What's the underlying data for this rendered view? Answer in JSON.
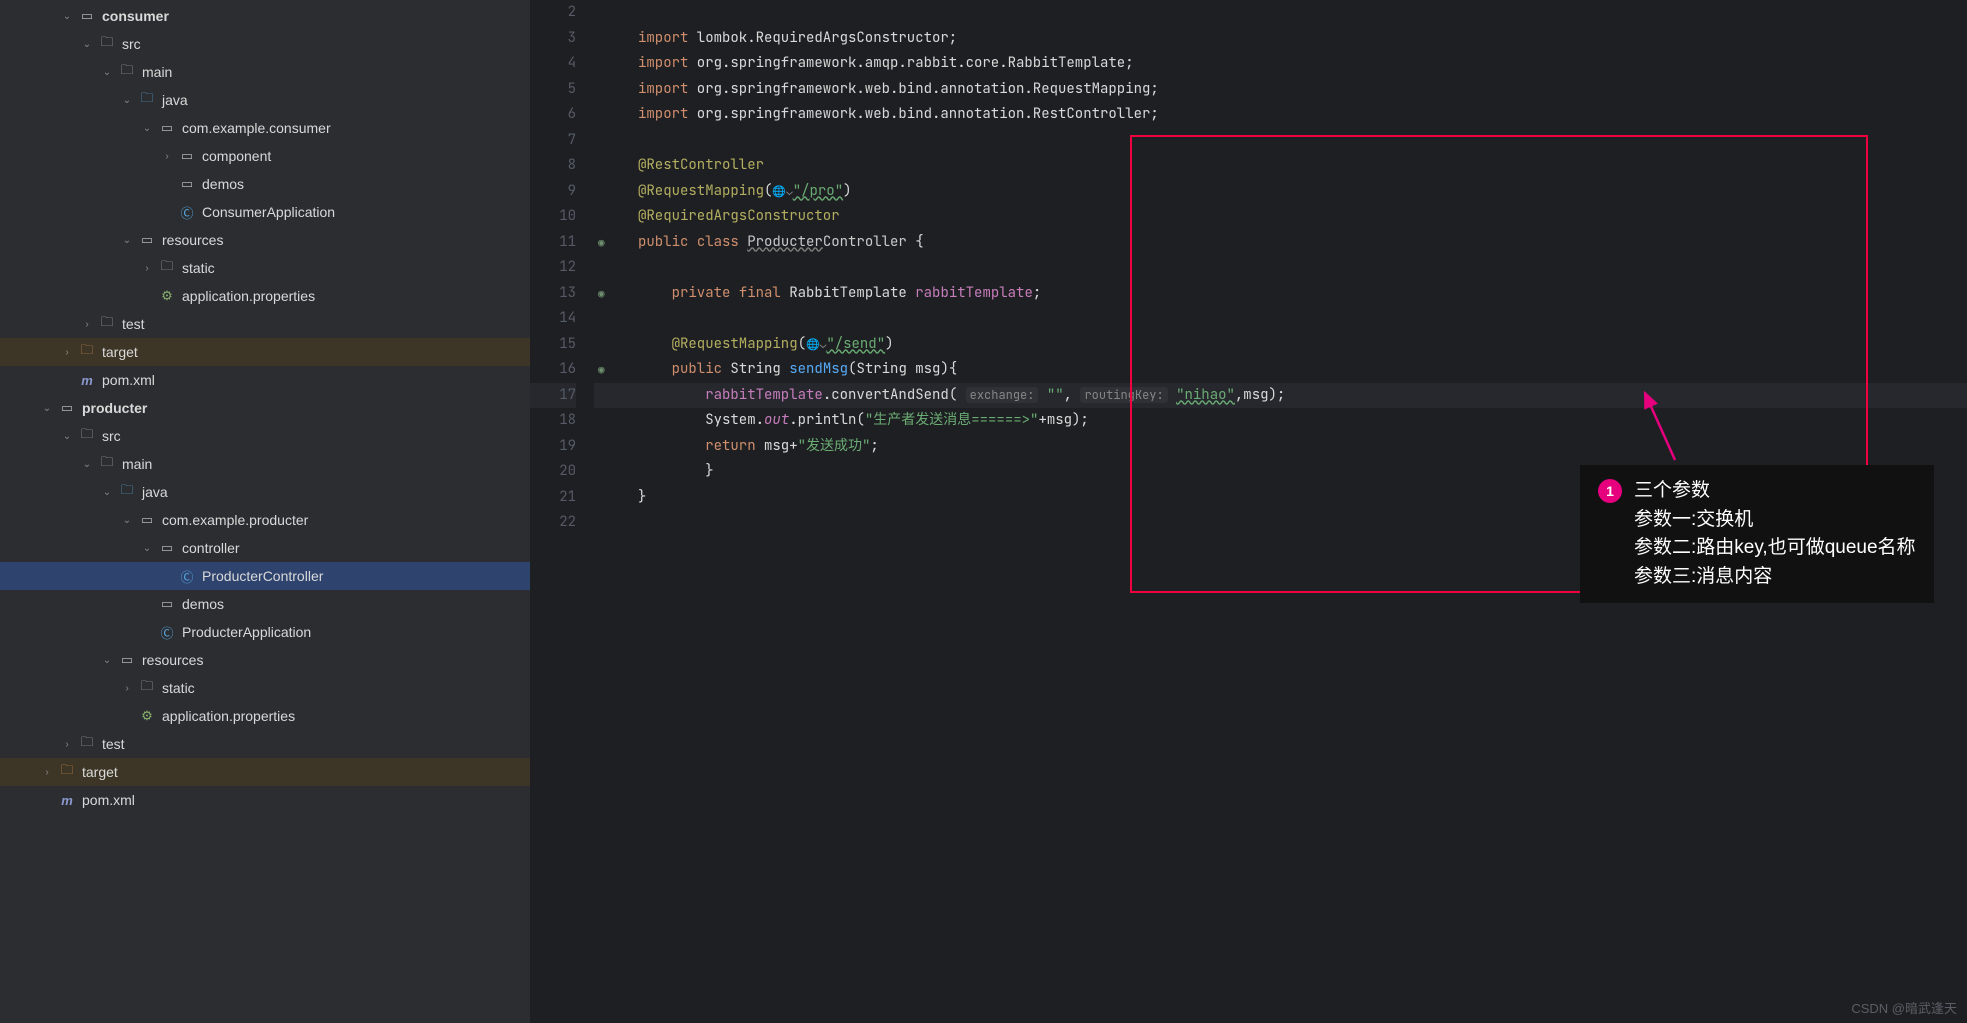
{
  "sidebar": {
    "items": [
      {
        "depth": 3,
        "arrow": "down",
        "icon": "module",
        "label": "consumer",
        "bold": true
      },
      {
        "depth": 4,
        "arrow": "down",
        "icon": "folder",
        "label": "src"
      },
      {
        "depth": 5,
        "arrow": "down",
        "icon": "folder",
        "label": "main"
      },
      {
        "depth": 6,
        "arrow": "down",
        "icon": "folder-src",
        "label": "java"
      },
      {
        "depth": 7,
        "arrow": "down",
        "icon": "package",
        "label": "com.example.consumer"
      },
      {
        "depth": 8,
        "arrow": "right",
        "icon": "package",
        "label": "component"
      },
      {
        "depth": 8,
        "arrow": "",
        "icon": "package",
        "label": "demos"
      },
      {
        "depth": 8,
        "arrow": "",
        "icon": "class",
        "label": "ConsumerApplication"
      },
      {
        "depth": 6,
        "arrow": "down",
        "icon": "res",
        "label": "resources"
      },
      {
        "depth": 7,
        "arrow": "right",
        "icon": "folder",
        "label": "static"
      },
      {
        "depth": 7,
        "arrow": "",
        "icon": "prop",
        "label": "application.properties"
      },
      {
        "depth": 4,
        "arrow": "right",
        "icon": "folder",
        "label": "test"
      },
      {
        "depth": 3,
        "arrow": "right",
        "icon": "folder-tgt",
        "label": "target",
        "hl": true
      },
      {
        "depth": 3,
        "arrow": "",
        "icon": "maven",
        "label": "pom.xml"
      },
      {
        "depth": 2,
        "arrow": "down",
        "icon": "module",
        "label": "producter",
        "bold": true
      },
      {
        "depth": 3,
        "arrow": "down",
        "icon": "folder",
        "label": "src"
      },
      {
        "depth": 4,
        "arrow": "down",
        "icon": "folder",
        "label": "main"
      },
      {
        "depth": 5,
        "arrow": "down",
        "icon": "folder-src",
        "label": "java"
      },
      {
        "depth": 6,
        "arrow": "down",
        "icon": "package",
        "label": "com.example.producter"
      },
      {
        "depth": 7,
        "arrow": "down",
        "icon": "package",
        "label": "controller"
      },
      {
        "depth": 8,
        "arrow": "",
        "icon": "class",
        "label": "ProducterController",
        "selected": true
      },
      {
        "depth": 7,
        "arrow": "",
        "icon": "package",
        "label": "demos"
      },
      {
        "depth": 7,
        "arrow": "",
        "icon": "class",
        "label": "ProducterApplication"
      },
      {
        "depth": 5,
        "arrow": "down",
        "icon": "res",
        "label": "resources"
      },
      {
        "depth": 6,
        "arrow": "right",
        "icon": "folder",
        "label": "static"
      },
      {
        "depth": 6,
        "arrow": "",
        "icon": "prop",
        "label": "application.properties"
      },
      {
        "depth": 3,
        "arrow": "right",
        "icon": "folder",
        "label": "test"
      },
      {
        "depth": 2,
        "arrow": "right",
        "icon": "folder-tgt",
        "label": "target",
        "hl": true
      },
      {
        "depth": 2,
        "arrow": "",
        "icon": "maven",
        "label": "pom.xml"
      }
    ]
  },
  "gutter": {
    "start": 2,
    "end": 22,
    "current": 17,
    "spring_lines": [
      11,
      13,
      16
    ]
  },
  "code": {
    "l2": "",
    "l3": {
      "kw": "import",
      "rest": " lombok.RequiredArgsConstructor;"
    },
    "l4": {
      "kw": "import",
      "rest": " org.springframework.amqp.rabbit.core.RabbitTemplate;"
    },
    "l5": {
      "kw": "import",
      "rest": " org.springframework.web.bind.annotation.RequestMapping;"
    },
    "l6": {
      "kw": "import",
      "rest": " org.springframework.web.bind.annotation.RestController;"
    },
    "l8": {
      "ann": "@RestController"
    },
    "l9": {
      "ann": "@RequestMapping",
      "str": "\"/pro\""
    },
    "l10": {
      "ann": "@RequiredArgsConstructor"
    },
    "l11": {
      "kw1": "public",
      "kw2": "class",
      "cls": "Producter",
      "cls2": "Controller",
      "brace": " {"
    },
    "l13": {
      "kw1": "private",
      "kw2": "final",
      "type": "RabbitTemplate",
      "name": "rabbitTemplate",
      ";": ";"
    },
    "l15": {
      "ann": "@RequestMapping",
      "str": "\"/send\""
    },
    "l16": {
      "kw": "public",
      "type": "String",
      "fn": "sendMsg",
      "params": "(String msg){"
    },
    "l17": {
      "obj": "rabbitTemplate",
      "dot": ".",
      "m": "convertAndSend",
      "open": "( ",
      "h1": "exchange:",
      "v1": "\"\"",
      "c1": ", ",
      "h2": "routingKey:",
      "v2": "\"nihao\"",
      "rest": ",msg);"
    },
    "l18": {
      "a": "System.",
      "b": "out",
      "c": ".println(",
      "str": "\"生产者发送消息======>\"",
      "d": "+msg);"
    },
    "l19": {
      "kw": "return",
      "rest": " msg+",
      "str": "\"发送成功\"",
      "end": ";"
    },
    "l20": "        }",
    "l21": "}"
  },
  "annotation": {
    "badge": "1",
    "line1": "三个参数",
    "line2": "参数一:交换机",
    "line3": "参数二:路由key,也可做queue名称",
    "line4": "参数三:消息内容"
  },
  "watermark": "CSDN @暗武逢天"
}
